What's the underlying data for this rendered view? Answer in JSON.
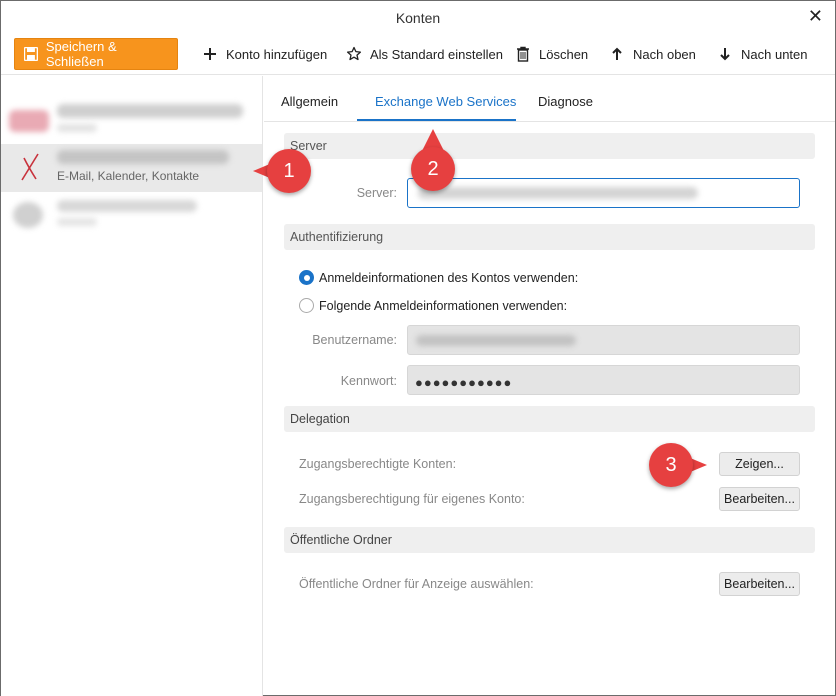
{
  "window": {
    "title": "Konten",
    "close_label": "✕"
  },
  "toolbar": {
    "save_close": "Speichern & Schließen",
    "add_account": "Konto hinzufügen",
    "set_default": "Als Standard einstellen",
    "delete": "Löschen",
    "move_up": "Nach oben",
    "move_down": "Nach unten",
    "accent_color": "#f7941d"
  },
  "sidebar": {
    "selected_account_subtitle": "E-Mail, Kalender, Kontakte"
  },
  "tabs": [
    {
      "label": "Allgemein"
    },
    {
      "label": "Exchange Web Services",
      "active": true
    },
    {
      "label": "Diagnose"
    }
  ],
  "server_section": {
    "title": "Server",
    "server_label": "Server:"
  },
  "auth_section": {
    "title": "Authentifizierung",
    "option_account": "Anmeldeinformationen des Kontos verwenden:",
    "option_custom": "Folgende Anmeldeinformationen verwenden:",
    "username_label": "Benutzername:",
    "password_label": "Kennwort:",
    "password_value": "●●●●●●●●●●●"
  },
  "delegation_section": {
    "title": "Delegation",
    "authorized_accounts_label": "Zugangsberechtigte Konten:",
    "authorized_accounts_button": "Zeigen...",
    "own_account_label": "Zugangsberechtigung für eigenes Konto:",
    "own_account_button": "Bearbeiten..."
  },
  "public_folders_section": {
    "title": "Öffentliche Ordner",
    "select_label": "Öffentliche Ordner für Anzeige auswählen:",
    "select_button": "Bearbeiten..."
  },
  "markers": [
    {
      "label": "1"
    },
    {
      "label": "2"
    },
    {
      "label": "3"
    }
  ],
  "colors": {
    "link_blue": "#1a73c8",
    "marker_red": "#e64040"
  }
}
